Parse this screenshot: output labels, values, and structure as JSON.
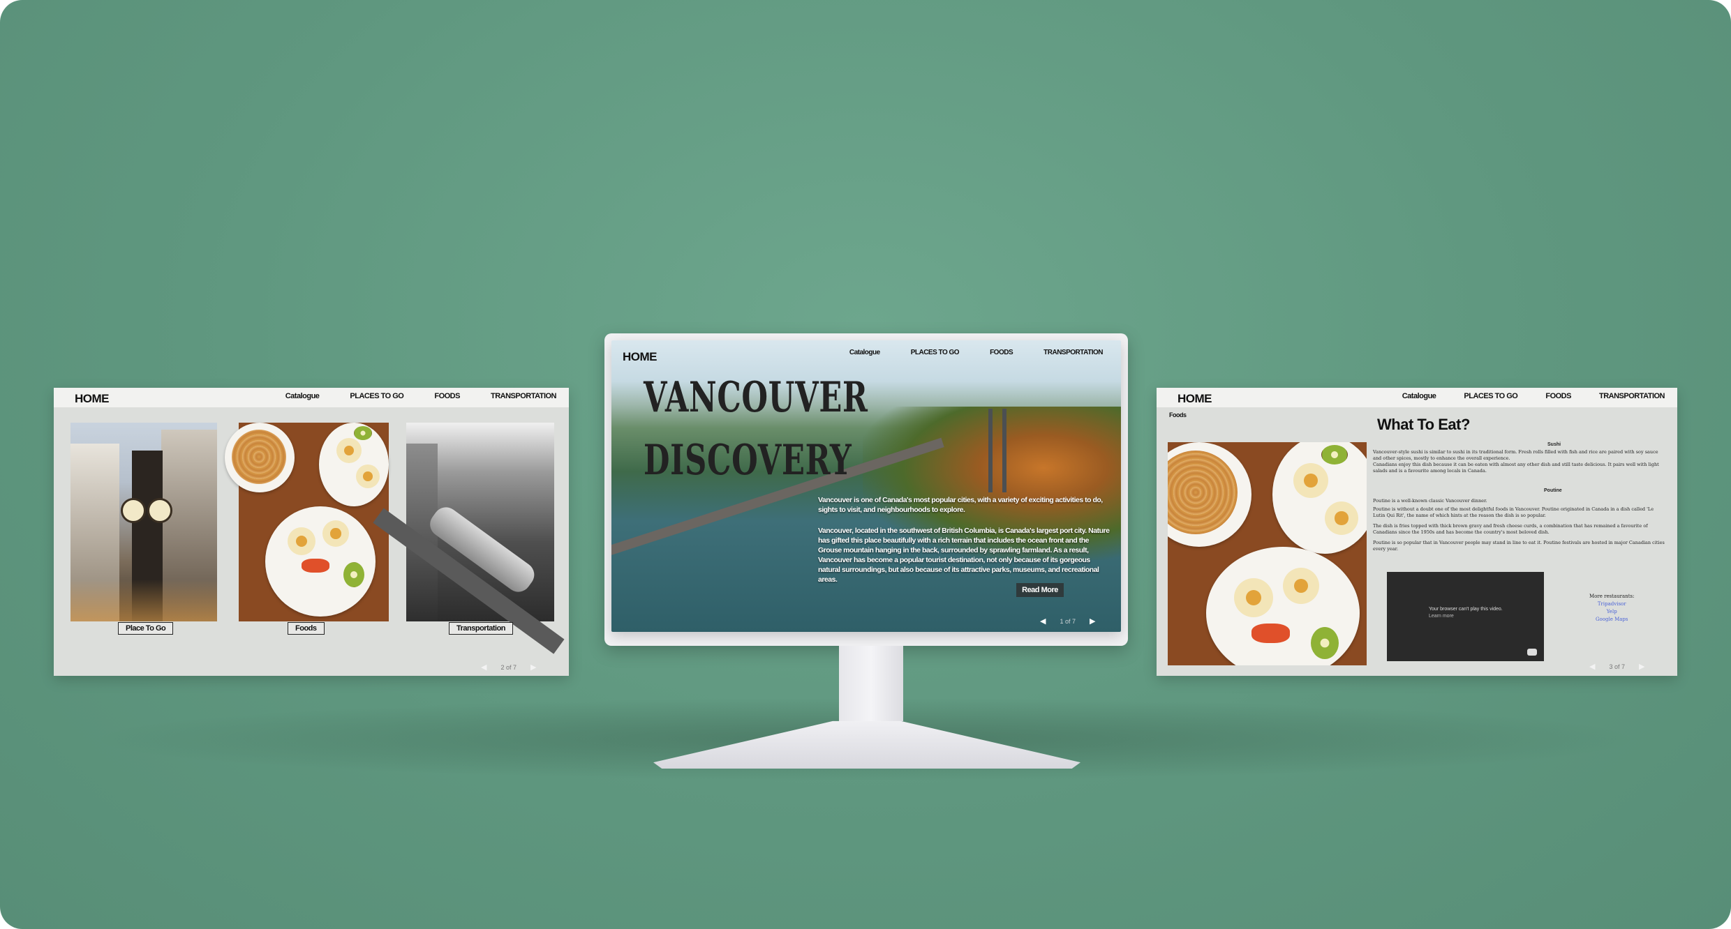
{
  "nav": {
    "home": "HOME",
    "links": [
      "Catalogue",
      "PLACES TO GO",
      "FOODS",
      "TRANSPORTATION"
    ]
  },
  "left_screen": {
    "nav_links": [
      "Catalogue",
      "PLACES TO GO",
      "FOODS",
      "TRANSPORTATION"
    ],
    "captions": [
      "Place To Go",
      "Foods",
      "Transportation"
    ],
    "pager": "2 of 7"
  },
  "center_screen": {
    "nav_links": [
      "Catalogue",
      "PLACES TO GO",
      "FOODS",
      "TRANSPORTATION"
    ],
    "hero_line1": "VANCOUVER",
    "hero_line2": "DISCOVERY",
    "text1": "Vancouver is one of Canada's most popular cities, with a variety of exciting activities to do, sights to visit, and neighbourhoods to explore.",
    "text2": "Vancouver, located in the southwest of British Columbia, is Canada's largest port city. Nature has gifted this place beautifully with a rich terrain that includes the ocean front and the Grouse mountain hanging in the back, surrounded by sprawling farmland. As a result, Vancouver has become a popular tourist destination, not only because of its gorgeous natural surroundings, but also because of its attractive parks, museums, and recreational areas.",
    "read_more": "Read More",
    "pager": "1 of 7"
  },
  "right_screen": {
    "nav_links": [
      "Catalogue",
      "PLACES TO GO",
      "FOODS",
      "TRANSPORTATION"
    ],
    "sub": "Foods",
    "title": "What To Eat?",
    "h1": "Sushi",
    "p1": "Vancouver-style sushi is similar to sushi in its traditional form. Fresh rolls filled with fish and rice are paired with soy sauce and other spices, mostly to enhance the overall experience.",
    "p1b": "Canadians enjoy this dish because it can be eaten with almost any other dish and still taste delicious. It pairs well with light salads and is a favourite among locals in Canada.",
    "h2": "Poutine",
    "p2": "Poutine is a well-known classic Vancouver dinner.",
    "p2b": "Poutine is without a doubt one of the most delightful foods in Vancouver. Poutine originated in Canada in a dish called 'Le Lutin Qui Rit', the name of which hints at the reason the dish is so popular.",
    "p2c": "The dish is fries topped with thick brown gravy and fresh cheese curds, a combination that has remained a favourite of Canadians since the 1950s and has become the country's most beloved dish.",
    "p2d": "Poutine is so popular that in Vancouver people may stand in line to eat it. Poutine festivals are hosted in major Canadian cities every year.",
    "video_msg": "Your browser can't play this video.",
    "video_msg2": "Learn more",
    "more_title": "More restaurants:",
    "more_links": [
      "Tripadvisor",
      "Yelp",
      "Google Maps"
    ],
    "pager": "3 of 7"
  },
  "colors": {
    "background": "#5f977f",
    "screen": "#dcdedb",
    "accent_link": "#4b63d6"
  },
  "icons": {
    "prev": "◀",
    "next": "▶"
  }
}
